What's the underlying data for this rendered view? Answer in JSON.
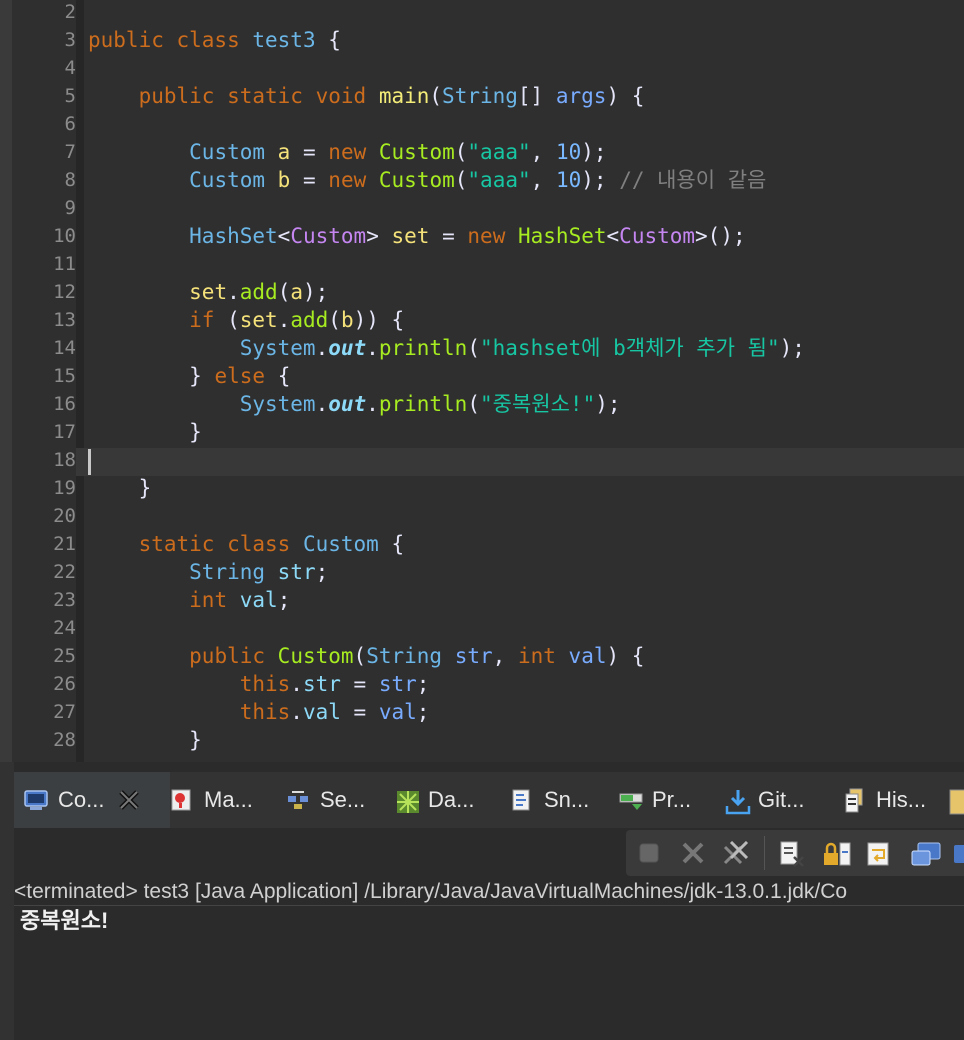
{
  "editor": {
    "line_numbers": [
      "2",
      "3",
      "4",
      "5",
      "6",
      "7",
      "8",
      "9",
      "10",
      "11",
      "12",
      "13",
      "14",
      "15",
      "16",
      "17",
      "18",
      "19",
      "20",
      "21",
      "22",
      "23",
      "24",
      "25",
      "26",
      "27",
      "28"
    ],
    "comment_line8": "// 내용이 같음",
    "string_aaa": "\"aaa\"",
    "string_added": "\"hashset에 b객체가 추가 됨\"",
    "string_dup": "\"중복원소!\"",
    "class_name": "test3"
  },
  "tabs": [
    {
      "label": "Co...",
      "icon": "console-icon",
      "active": true
    },
    {
      "label": "Ma...",
      "icon": "markers-icon"
    },
    {
      "label": "Se...",
      "icon": "servers-icon"
    },
    {
      "label": "Da...",
      "icon": "data-source-icon"
    },
    {
      "label": "Sn...",
      "icon": "snippets-icon"
    },
    {
      "label": "Pr...",
      "icon": "progress-icon"
    },
    {
      "label": "Git...",
      "icon": "git-icon"
    },
    {
      "label": "His...",
      "icon": "history-icon"
    }
  ],
  "toolbar": [
    "stop-icon",
    "remove-launch-icon",
    "remove-all-terminated-icon",
    "clear-console-icon",
    "scroll-lock-icon",
    "word-wrap-icon",
    "show-on-output-icon",
    "open-console-icon"
  ],
  "console": {
    "header": "<terminated> test3 [Java Application] /Library/Java/JavaVirtualMachines/jdk-13.0.1.jdk/Co",
    "output": "중복원소!"
  },
  "colors": {
    "editor_bg": "#2f2f2f",
    "keyword": "#cc6c1d",
    "string": "#17c6a3",
    "method": "#a7ec21"
  }
}
